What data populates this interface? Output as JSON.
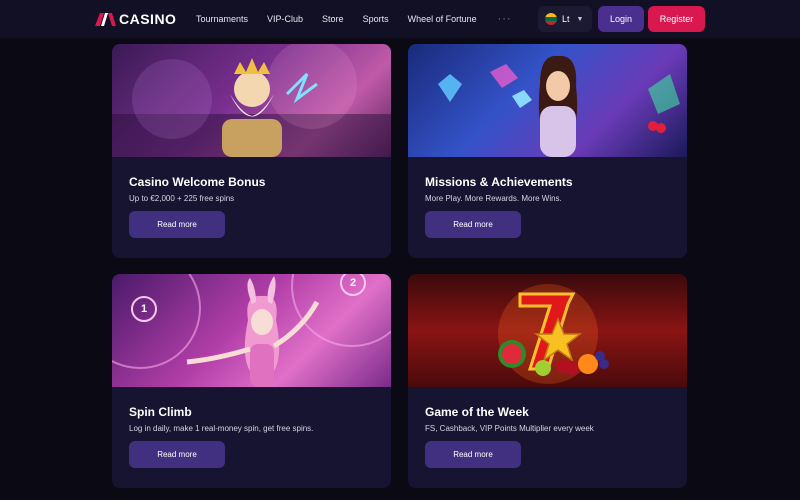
{
  "header": {
    "logo_text": "CASINO",
    "nav": [
      "Tournaments",
      "VIP-Club",
      "Store",
      "Sports",
      "Wheel of Fortune"
    ],
    "more_icon": "···",
    "language": "Lt",
    "login_label": "Login",
    "register_label": "Register"
  },
  "colors": {
    "brand_red": "#d8184f",
    "accent_purple": "#4a2f8f",
    "card_bg": "#161430",
    "page_bg": "#0b0a14"
  },
  "cards": [
    {
      "title": "Casino Welcome Bonus",
      "subtitle": "Up to €2,000 + 225 free spins",
      "button": "Read more",
      "image_icon": "zeus-illustration-icon"
    },
    {
      "title": "Missions & Achievements",
      "subtitle": "More Play. More Rewards. More Wins.",
      "button": "Read more",
      "image_icon": "woman-with-diamond-illustration-icon"
    },
    {
      "title": "Spin Climb",
      "subtitle": "Log in daily, make 1 real-money spin, get free spins.",
      "button": "Read more",
      "image_icon": "bunny-girl-illustration-icon"
    },
    {
      "title": "Game of the Week",
      "subtitle": "FS, Cashback, VIP Points Multiplier every week",
      "button": "Read more",
      "image_icon": "lucky-seven-fruits-illustration-icon"
    }
  ],
  "spin_climb_badges": [
    "1",
    "2"
  ]
}
